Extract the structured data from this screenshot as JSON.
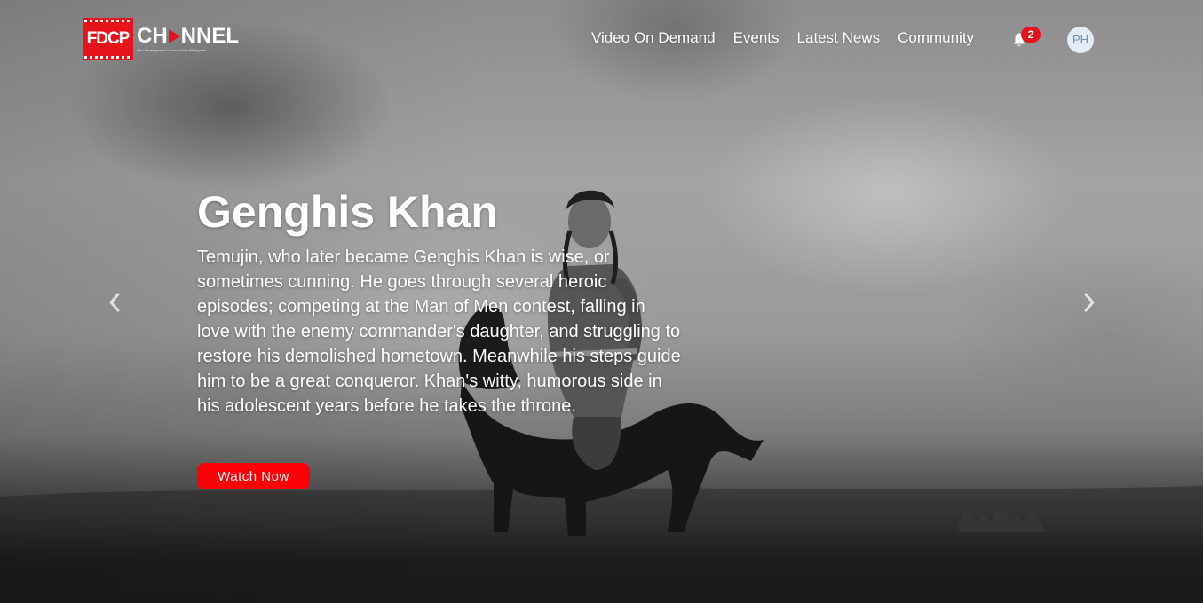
{
  "brand": {
    "logo_mark": "FDCP",
    "logo_name_a": "CH",
    "logo_name_b": "NNEL",
    "logo_tagline": "Film Development Council of the Philippines"
  },
  "nav": {
    "links": [
      {
        "label": "Video On Demand"
      },
      {
        "label": "Events"
      },
      {
        "label": "Latest News"
      },
      {
        "label": "Community"
      }
    ],
    "notifications": {
      "count": "2",
      "icon": "bell-icon"
    },
    "avatar_initials": "PH"
  },
  "hero": {
    "title": "Genghis Khan",
    "description": "Temujin, who later became Genghis Khan is wise, or sometimes cunning. He goes through several heroic episodes; competing at the Man of Men contest, falling in love with the enemy commander's daughter, and struggling to restore his demolished hometown. Meanwhile his steps guide him to be a great conqueror. Khan's witty, humorous side in his adolescent years before he takes the throne.",
    "cta_label": "Watch Now",
    "prev_icon": "chevron-left-icon",
    "next_icon": "chevron-right-icon"
  },
  "colors": {
    "accent": "#fb0006",
    "logo_red": "#e8121b",
    "avatar_bg": "#e2ebf6",
    "avatar_text": "#6d8bc2",
    "page_bottom": "#050708"
  }
}
